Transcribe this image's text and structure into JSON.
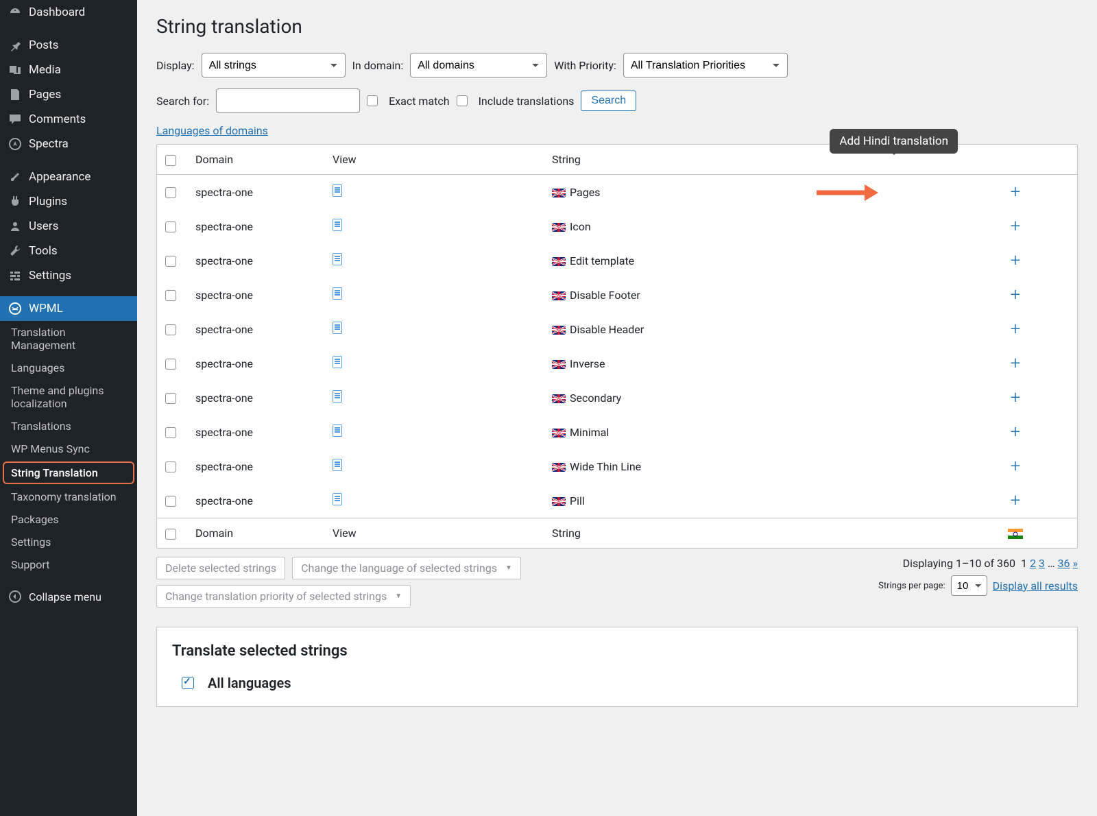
{
  "sidebar": {
    "main_items": [
      {
        "label": "Dashboard",
        "icon": "gauge-icon"
      },
      {
        "label": "Posts",
        "icon": "pin-icon"
      },
      {
        "label": "Media",
        "icon": "media-icon"
      },
      {
        "label": "Pages",
        "icon": "page-icon"
      },
      {
        "label": "Comments",
        "icon": "comment-icon"
      },
      {
        "label": "Spectra",
        "icon": "spectra-icon"
      },
      {
        "label": "Appearance",
        "icon": "brush-icon"
      },
      {
        "label": "Plugins",
        "icon": "plugin-icon"
      },
      {
        "label": "Users",
        "icon": "user-icon"
      },
      {
        "label": "Tools",
        "icon": "wrench-icon"
      },
      {
        "label": "Settings",
        "icon": "settings-icon"
      },
      {
        "label": "WPML",
        "icon": "globe-icon",
        "active": true
      }
    ],
    "sub_items": [
      "Translation Management",
      "Languages",
      "Theme and plugins localization",
      "Translations",
      "WP Menus Sync",
      "String Translation",
      "Taxonomy translation",
      "Packages",
      "Settings",
      "Support"
    ],
    "highlighted_sub": "String Translation",
    "collapse": "Collapse menu"
  },
  "page": {
    "title": "String translation"
  },
  "filters": {
    "display_label": "Display:",
    "display_value": "All strings",
    "in_domain_label": "In domain:",
    "in_domain_value": "All domains",
    "priority_label": "With Priority:",
    "priority_value": "All Translation Priorities",
    "search_label": "Search for:",
    "search_value": "",
    "exact_match": "Exact match",
    "include_translations": "Include translations",
    "search_btn": "Search",
    "lang_of_domains": "Languages of domains"
  },
  "table": {
    "headers": {
      "domain": "Domain",
      "view": "View",
      "string": "String"
    },
    "rows": [
      {
        "domain": "spectra-one",
        "string": "Pages"
      },
      {
        "domain": "spectra-one",
        "string": "Icon"
      },
      {
        "domain": "spectra-one",
        "string": "Edit template"
      },
      {
        "domain": "spectra-one",
        "string": "Disable Footer"
      },
      {
        "domain": "spectra-one",
        "string": "Disable Header"
      },
      {
        "domain": "spectra-one",
        "string": "Inverse"
      },
      {
        "domain": "spectra-one",
        "string": "Secondary"
      },
      {
        "domain": "spectra-one",
        "string": "Minimal"
      },
      {
        "domain": "spectra-one",
        "string": "Wide Thin Line"
      },
      {
        "domain": "spectra-one",
        "string": "Pill"
      }
    ]
  },
  "tooltip": "Add Hindi translation",
  "actions": {
    "delete": "Delete selected strings",
    "change_lang": "Change the language of selected strings",
    "change_priority": "Change translation priority of selected strings"
  },
  "pager": {
    "summary": "Displaying 1–10 of 360",
    "pages": [
      "1",
      "2",
      "3",
      "…",
      "36",
      "»"
    ],
    "per_page_label": "Strings per page:",
    "per_page_value": "10",
    "display_all": "Display all results"
  },
  "translate_panel": {
    "heading": "Translate selected strings",
    "all_languages": "All languages"
  }
}
